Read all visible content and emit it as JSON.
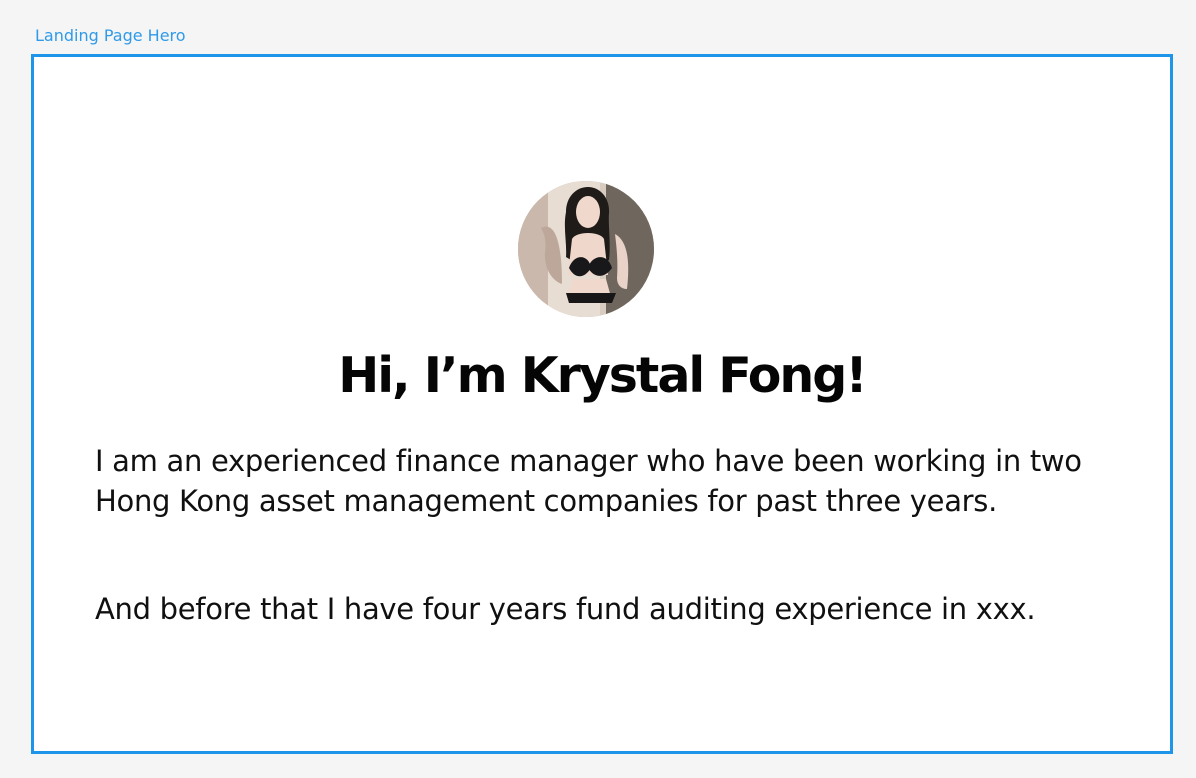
{
  "frame": {
    "label": "Landing Page Hero",
    "accent_color": "#1F95EA"
  },
  "hero": {
    "avatar_icon": "profile-photo",
    "title": "Hi, I’m Krystal Fong!",
    "paragraphs": [
      "I am an experienced finance manager who have been working in two Hong Kong asset management companies for past three years.",
      "And before that I have four years fund auditing experience in xxx."
    ]
  }
}
